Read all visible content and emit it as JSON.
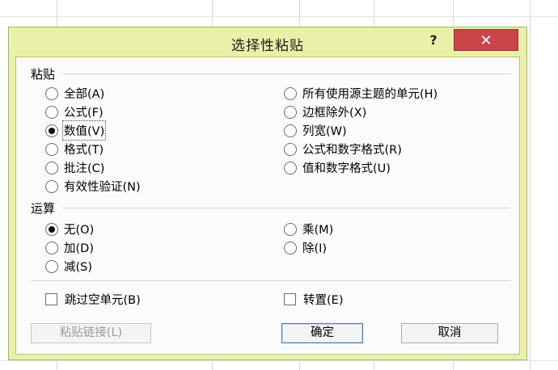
{
  "dialog": {
    "title": "选择性粘贴",
    "help_label": "?",
    "close_label": "✕"
  },
  "paste": {
    "heading": "粘贴",
    "left_options": [
      {
        "label": "全部(A)",
        "selected": false
      },
      {
        "label": "公式(F)",
        "selected": false
      },
      {
        "label": "数值(V)",
        "selected": true
      },
      {
        "label": "格式(T)",
        "selected": false
      },
      {
        "label": "批注(C)",
        "selected": false
      },
      {
        "label": "有效性验证(N)",
        "selected": false
      }
    ],
    "right_options": [
      {
        "label": "所有使用源主题的单元(H)",
        "selected": false
      },
      {
        "label": "边框除外(X)",
        "selected": false
      },
      {
        "label": "列宽(W)",
        "selected": false
      },
      {
        "label": "公式和数字格式(R)",
        "selected": false
      },
      {
        "label": "值和数字格式(U)",
        "selected": false
      }
    ]
  },
  "operation": {
    "heading": "运算",
    "left_options": [
      {
        "label": "无(O)",
        "selected": true
      },
      {
        "label": "加(D)",
        "selected": false
      },
      {
        "label": "减(S)",
        "selected": false
      }
    ],
    "right_options": [
      {
        "label": "乘(M)",
        "selected": false
      },
      {
        "label": "除(I)",
        "selected": false
      }
    ]
  },
  "checkboxes": {
    "skip_blanks": {
      "label": "跳过空单元(B)",
      "checked": false
    },
    "transpose": {
      "label": "转置(E)",
      "checked": false
    }
  },
  "buttons": {
    "paste_link": "粘贴链接(L)",
    "ok": "确定",
    "cancel": "取消"
  }
}
